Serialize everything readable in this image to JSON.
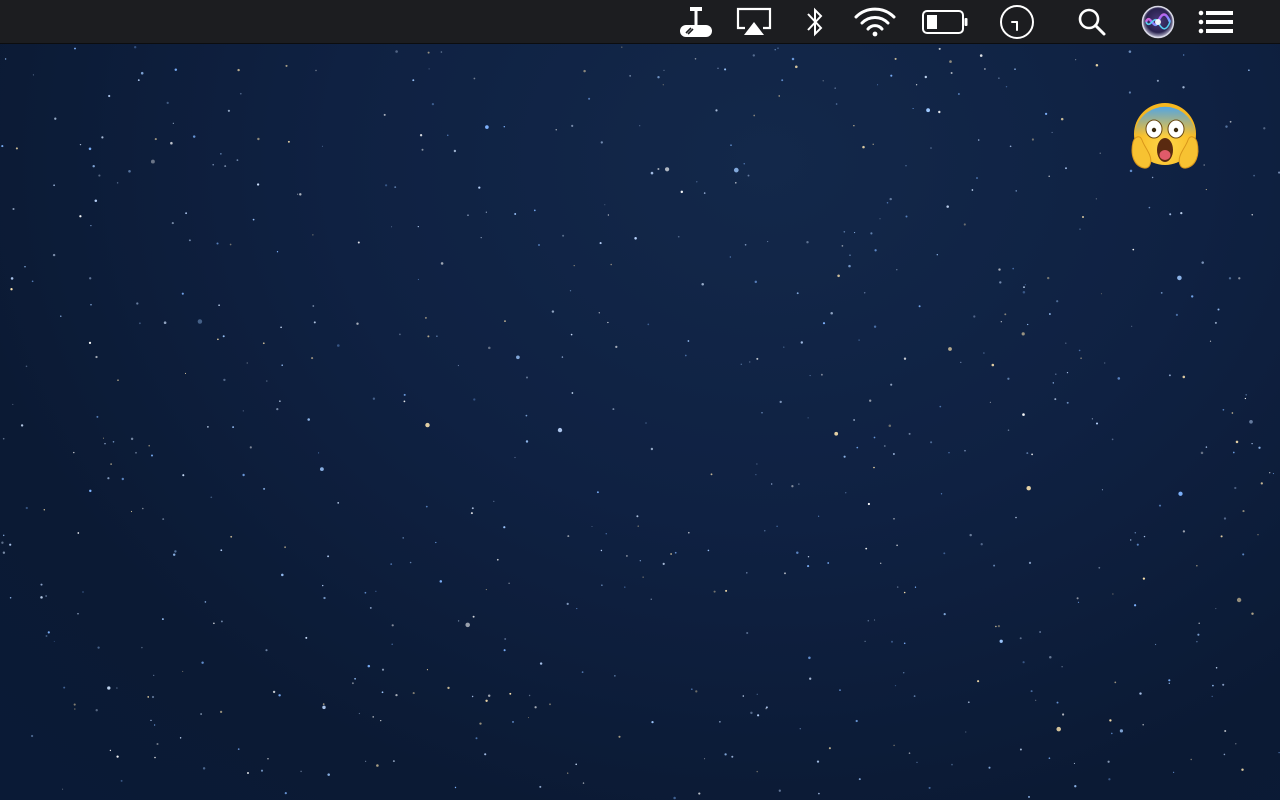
{
  "desktop": {
    "wallpaper": "starry-night-sky",
    "background_color": "#0f2142"
  },
  "menubar": {
    "background_color": "#1c1d20",
    "icon_color": "#ffffff",
    "status_items": [
      {
        "name": "network-drive-icon"
      },
      {
        "name": "airplay-icon"
      },
      {
        "name": "bluetooth-icon"
      },
      {
        "name": "wifi-icon"
      },
      {
        "name": "battery-icon",
        "level": 0.3
      },
      {
        "name": "clock-icon"
      },
      {
        "name": "spotlight-search-icon"
      },
      {
        "name": "siri-icon"
      },
      {
        "name": "notification-center-icon"
      }
    ]
  },
  "desktop_items": [
    {
      "name": "screaming-face-emoji-icon"
    }
  ]
}
